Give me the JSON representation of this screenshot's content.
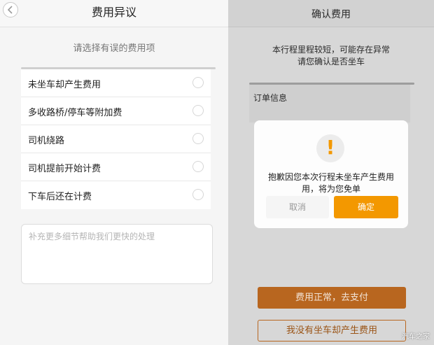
{
  "left": {
    "title": "费用异议",
    "prompt": "请选择有误的费用项",
    "options": [
      {
        "label": "未坐车却产生费用"
      },
      {
        "label": "多收路桥/停车等附加费"
      },
      {
        "label": "司机绕路"
      },
      {
        "label": "司机提前开始计费"
      },
      {
        "label": "下车后还在计费"
      }
    ],
    "comment_placeholder": "补充更多细节帮助我们更快的处理"
  },
  "right": {
    "title": "确认费用",
    "message_line1": "本行程里程较短，可能存在异常",
    "message_line2": "请您确认是否坐车",
    "order_label": "订单信息",
    "dialog": {
      "icon": "exclamation-icon",
      "icon_glyph": "!",
      "message_line1": "抱歉因您本次行程未坐车产生费用",
      "message_line2": "用，将为您免单",
      "cancel_label": "取消",
      "confirm_label": "确定"
    },
    "pay_button": "费用正常，去支付",
    "not_ride_button": "我没有坐车却产生费用"
  },
  "watermark": "汽车之家",
  "colors": {
    "accent": "#f39800",
    "pay_button": "#b8661f"
  }
}
